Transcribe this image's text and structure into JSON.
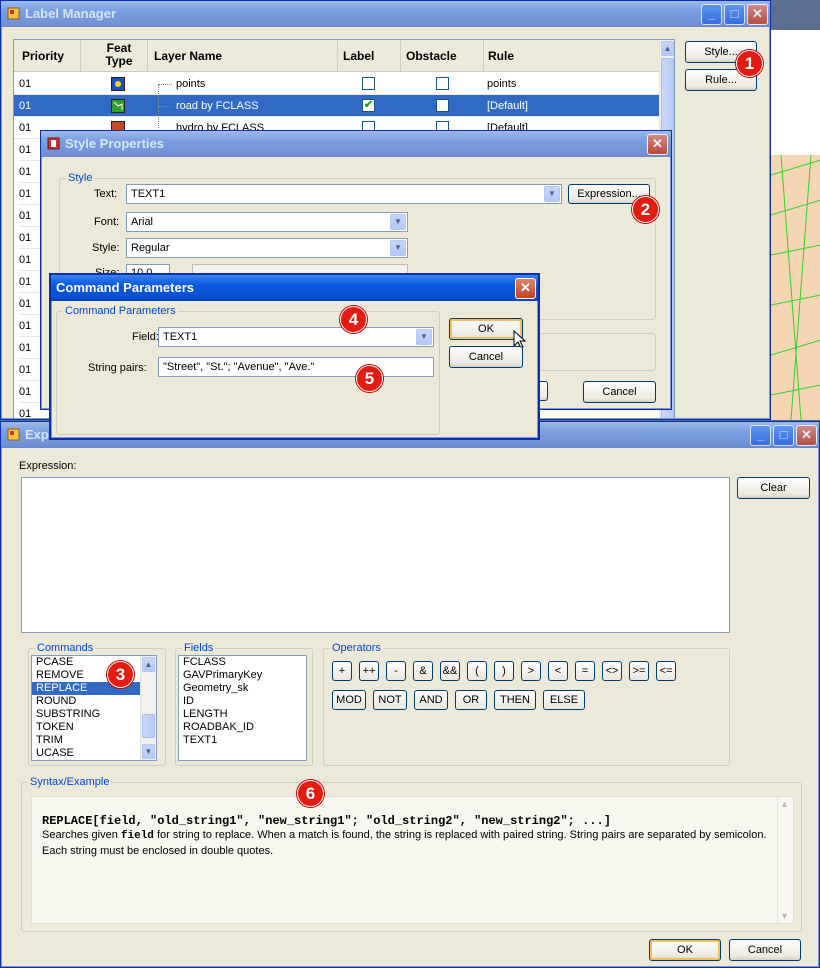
{
  "label_manager": {
    "title": "Label Manager",
    "columns": [
      "Priority",
      "Feat\nType",
      "Layer Name",
      "Label",
      "Obstacle",
      "Rule"
    ],
    "rows": [
      {
        "priority": "01",
        "layer": "points",
        "label": false,
        "obstacle": false,
        "rule": "points",
        "selected": false
      },
      {
        "priority": "01",
        "layer": "road by FCLASS",
        "label": true,
        "obstacle": false,
        "rule": "[Default]",
        "selected": true
      },
      {
        "priority": "01",
        "layer": "hydro by FCLASS",
        "label": false,
        "obstacle": false,
        "rule": "[Default]",
        "selected": false
      }
    ],
    "extra_priorities": [
      "01",
      "01",
      "01",
      "01",
      "01",
      "01",
      "01",
      "01",
      "01",
      "01",
      "01",
      "01",
      "01"
    ],
    "style_button": "Style...",
    "rule_button": "Rule...",
    "feat_colors": [
      "#1a4fc4",
      "#2f9e2c",
      "#c8482a"
    ]
  },
  "style_properties": {
    "title": "Style Properties",
    "group": "Style",
    "text_label": "Text:",
    "text_value": "TEXT1",
    "expression_button": "Expression...",
    "font_label": "Font:",
    "font_value": "Arial",
    "style_label": "Style:",
    "style_value": "Regular",
    "size_label": "Size:",
    "size_value": "10.0",
    "ok_partial": "K",
    "cancel_button": "Cancel"
  },
  "command_parameters": {
    "title": "Command Parameters",
    "group": "Command Parameters",
    "field_label": "Field:",
    "field_value": "TEXT1",
    "pairs_label": "String pairs:",
    "pairs_value": "\"Street\", \"St.\"; \"Avenue\", \"Ave.\"",
    "ok_button": "OK",
    "cancel_button": "Cancel"
  },
  "expression": {
    "title": "Exp",
    "expression_label": "Expression:",
    "clear_button": "Clear",
    "commands_group": "Commands",
    "commands": [
      "PCASE",
      "REMOVE",
      "REPLACE",
      "ROUND",
      "SUBSTRING",
      "TOKEN",
      "TRIM",
      "UCASE"
    ],
    "selected_command": "REPLACE",
    "fields_group": "Fields",
    "fields": [
      "FCLASS",
      "GAVPrimaryKey",
      "Geometry_sk",
      "ID",
      "LENGTH",
      "ROADBAK_ID",
      "TEXT1"
    ],
    "operators_group": "Operators",
    "operators_row1": [
      "+",
      "++",
      "-",
      "&",
      "&&",
      "(",
      ")",
      ">",
      "<",
      "=",
      "<>",
      ">=",
      "<="
    ],
    "operators_row2": [
      "MOD",
      "NOT",
      "AND",
      "OR",
      "THEN",
      "ELSE"
    ],
    "syntax_group": "Syntax/Example",
    "syntax_line": "REPLACE[field, \"old_string1\", \"new_string1\"; \"old_string2\", \"new_string2\"; ...]",
    "desc_1a": "Searches given ",
    "desc_1b": "field",
    "desc_1c": " for string to replace. When a match is found, the string is replaced with paired string. String pairs are separated by semicolon.",
    "desc_2": "Each string must be enclosed in double quotes.",
    "ok_button": "OK",
    "cancel_button": "Cancel"
  },
  "badges": [
    "1",
    "2",
    "3",
    "4",
    "5",
    "6"
  ]
}
